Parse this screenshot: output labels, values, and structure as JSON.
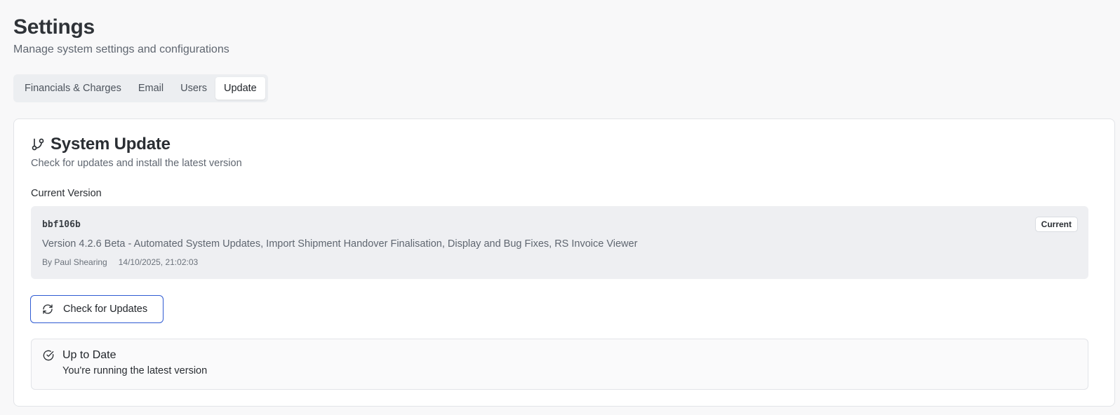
{
  "page": {
    "title": "Settings",
    "subtitle": "Manage system settings and configurations"
  },
  "tabs": [
    {
      "label": "Financials & Charges",
      "active": false
    },
    {
      "label": "Email",
      "active": false
    },
    {
      "label": "Users",
      "active": false
    },
    {
      "label": "Update",
      "active": true
    }
  ],
  "update_card": {
    "icon": "git-branch-icon",
    "title": "System Update",
    "subtitle": "Check for updates and install the latest version",
    "current_version_label": "Current Version",
    "current_version": {
      "commit": "bbf106b",
      "badge": "Current",
      "description": "Version 4.2.6 Beta - Automated System Updates, Import Shipment Handover Finalisation, Display and Bug Fixes, RS Invoice Viewer",
      "author": "By Paul Shearing",
      "timestamp": "14/10/2025, 21:02:03"
    },
    "check_button": {
      "icon": "refresh-icon",
      "label": "Check for Updates"
    },
    "status": {
      "icon": "check-circle-icon",
      "title": "Up to Date",
      "message": "You're running the latest version"
    }
  },
  "colors": {
    "background": "#f8f8f9",
    "card": "#ffffff",
    "accent_border": "#2f5bd3",
    "muted_text": "#5f6670"
  }
}
